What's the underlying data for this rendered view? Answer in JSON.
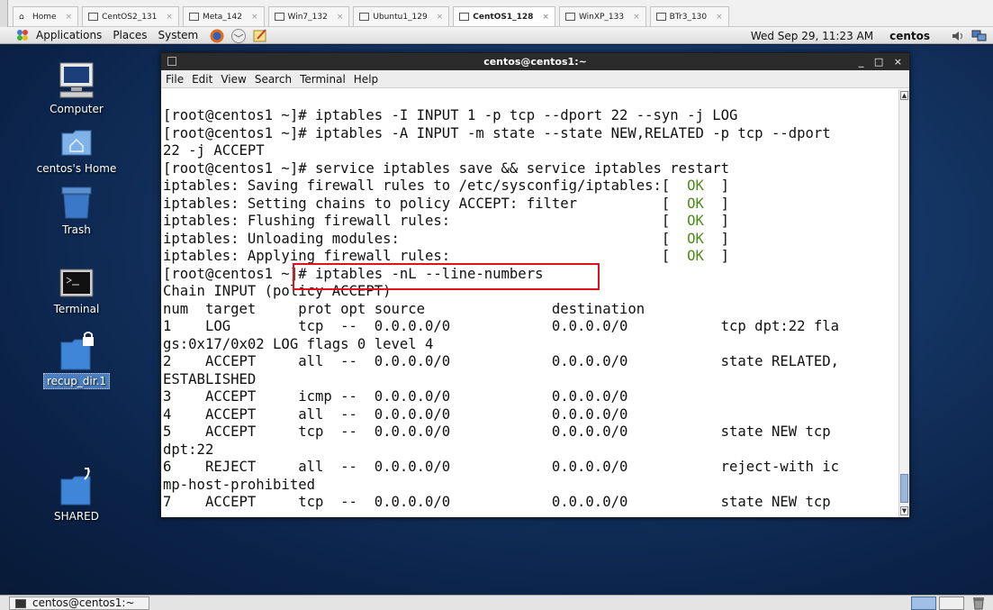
{
  "vm_tabs": [
    {
      "label": "Home",
      "active": false
    },
    {
      "label": "CentOS2_131",
      "active": false
    },
    {
      "label": "Meta_142",
      "active": false
    },
    {
      "label": "Win7_132",
      "active": false
    },
    {
      "label": "Ubuntu1_129",
      "active": false
    },
    {
      "label": "CentOS1_128",
      "active": true
    },
    {
      "label": "WinXP_133",
      "active": false
    },
    {
      "label": "BTr3_130",
      "active": false
    }
  ],
  "top_panel": {
    "menus": [
      "Applications",
      "Places",
      "System"
    ],
    "clock": "Wed Sep 29, 11:23 AM",
    "user": "centos"
  },
  "desktop_icons": [
    {
      "label": "Computer",
      "icon": "computer-icon"
    },
    {
      "label": "centos's Home",
      "icon": "home-folder-icon"
    },
    {
      "label": "Trash",
      "icon": "trash-icon"
    },
    {
      "label": "Terminal",
      "icon": "terminal-icon"
    },
    {
      "label": "recup_dir.1",
      "icon": "locked-folder-icon"
    },
    {
      "label": "SHARED",
      "icon": "shared-folder-icon"
    }
  ],
  "terminal": {
    "title": "centos@centos1:~",
    "menu": [
      "File",
      "Edit",
      "View",
      "Search",
      "Terminal",
      "Help"
    ],
    "lines": [
      "[root@centos1 ~]# iptables -I INPUT 1 -p tcp --dport 22 --syn -j LOG",
      "[root@centos1 ~]# iptables -A INPUT -m state --state NEW,RELATED -p tcp --dport",
      "22 -j ACCEPT",
      "[root@centos1 ~]# service iptables save && service iptables restart",
      "iptables: Saving firewall rules to /etc/sysconfig/iptables:[  ",
      "iptables: Setting chains to policy ACCEPT: filter          [  ",
      "iptables: Flushing firewall rules:                         [  ",
      "iptables: Unloading modules:                               [  ",
      "iptables: Applying firewall rules:                         [  ",
      "[root@centos1 ~]# iptables -nL --line-numbers",
      "Chain INPUT (policy ACCEPT)",
      "num  target     prot opt source               destination",
      "1    LOG        tcp  --  0.0.0.0/0            0.0.0.0/0           tcp dpt:22 fla",
      "gs:0x17/0x02 LOG flags 0 level 4",
      "2    ACCEPT     all  --  0.0.0.0/0            0.0.0.0/0           state RELATED,",
      "ESTABLISHED",
      "3    ACCEPT     icmp --  0.0.0.0/0            0.0.0.0/0",
      "4    ACCEPT     all  --  0.0.0.0/0            0.0.0.0/0",
      "5    ACCEPT     tcp  --  0.0.0.0/0            0.0.0.0/0           state NEW tcp",
      "dpt:22",
      "6    REJECT     all  --  0.0.0.0/0            0.0.0.0/0           reject-with ic",
      "mp-host-prohibited",
      "7    ACCEPT     tcp  --  0.0.0.0/0            0.0.0.0/0           state NEW tcp"
    ],
    "ok_text": "OK",
    "ok_suffix": "  ]"
  },
  "taskbar": {
    "window_label": "centos@centos1:~"
  },
  "colors": {
    "ok_green": "#4e8a1a",
    "highlight_red": "#e0121a",
    "desktop_blue": "#143563"
  }
}
